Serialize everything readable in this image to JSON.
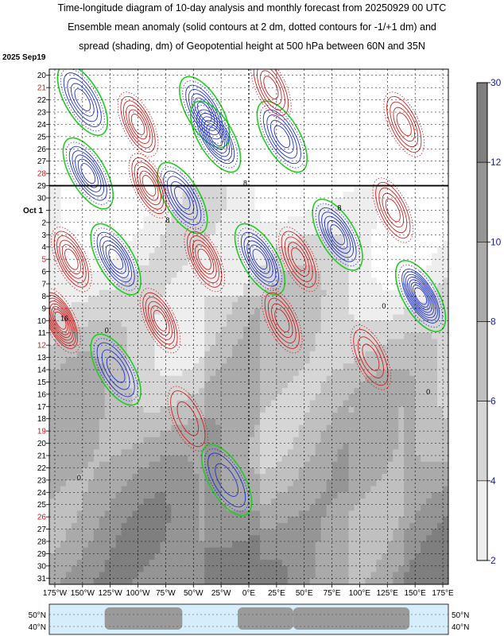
{
  "title": {
    "line1": "Time-longitude diagram of 10-day analysis and monthly forecast from 20250929 00 UTC",
    "line2": "Ensemble mean anomaly (solid contours at 2 dm, dotted contours for -1/+1 dm) and",
    "line3": "spread (shading, dm) of Geopotential height at 500 hPa between 60N and 35N"
  },
  "start_label": "2025 Sep19",
  "colors": {
    "positive": "#d42020",
    "negative": "#2233cc",
    "zero": "#22cc22",
    "weekend": "#dd1111",
    "colorbar_labels": "#1a1aa0"
  },
  "chart_data": {
    "type": "heatmap",
    "subtype": "time-longitude (Hovmoller) diagram",
    "analysis_end_line": "29",
    "y_ticks": [
      {
        "label": "20",
        "weekend": false
      },
      {
        "label": "21",
        "weekend": true
      },
      {
        "label": "22",
        "weekend": false
      },
      {
        "label": "23",
        "weekend": false
      },
      {
        "label": "24",
        "weekend": false
      },
      {
        "label": "25",
        "weekend": false
      },
      {
        "label": "26",
        "weekend": false
      },
      {
        "label": "27",
        "weekend": false
      },
      {
        "label": "28",
        "weekend": true
      },
      {
        "label": "29",
        "weekend": false
      },
      {
        "label": "30",
        "weekend": false
      },
      {
        "label": "Oct 1",
        "weekend": false
      },
      {
        "label": "2",
        "weekend": false
      },
      {
        "label": "3",
        "weekend": false
      },
      {
        "label": "4",
        "weekend": false
      },
      {
        "label": "5",
        "weekend": true
      },
      {
        "label": "6",
        "weekend": false
      },
      {
        "label": "7",
        "weekend": false
      },
      {
        "label": "8",
        "weekend": false
      },
      {
        "label": "9",
        "weekend": false
      },
      {
        "label": "10",
        "weekend": false
      },
      {
        "label": "11",
        "weekend": false
      },
      {
        "label": "12",
        "weekend": true
      },
      {
        "label": "13",
        "weekend": false
      },
      {
        "label": "14",
        "weekend": false
      },
      {
        "label": "15",
        "weekend": false
      },
      {
        "label": "16",
        "weekend": false
      },
      {
        "label": "17",
        "weekend": false
      },
      {
        "label": "18",
        "weekend": false
      },
      {
        "label": "19",
        "weekend": true
      },
      {
        "label": "20",
        "weekend": false
      },
      {
        "label": "21",
        "weekend": false
      },
      {
        "label": "22",
        "weekend": false
      },
      {
        "label": "23",
        "weekend": false
      },
      {
        "label": "24",
        "weekend": false
      },
      {
        "label": "25",
        "weekend": false
      },
      {
        "label": "26",
        "weekend": true
      },
      {
        "label": "27",
        "weekend": false
      },
      {
        "label": "28",
        "weekend": false
      },
      {
        "label": "29",
        "weekend": false
      },
      {
        "label": "30",
        "weekend": false
      },
      {
        "label": "31",
        "weekend": false
      }
    ],
    "x_ticks": [
      "175°W",
      "150°W",
      "125°W",
      "100°W",
      "75°W",
      "50°W",
      "25°W",
      "0°E",
      "25°E",
      "50°E",
      "75°E",
      "100°E",
      "125°E",
      "150°E",
      "175°E"
    ],
    "xlim": [
      -180,
      180
    ],
    "colorbar": {
      "ticks": [
        "30",
        "12",
        "10",
        "8",
        "6",
        "4",
        "2"
      ]
    },
    "shading_levels": [
      {
        "lo": 2,
        "hi": 4,
        "color": "#eeeeee"
      },
      {
        "lo": 4,
        "hi": 6,
        "color": "#d6d6d6"
      },
      {
        "lo": 6,
        "hi": 8,
        "color": "#c0c0c0"
      },
      {
        "lo": 8,
        "hi": 10,
        "color": "#aaaaaa"
      },
      {
        "lo": 10,
        "hi": 12,
        "color": "#959595"
      },
      {
        "lo": 12,
        "hi": 30,
        "color": "#7f7f7f"
      }
    ],
    "contour_labels": [
      "0",
      "8",
      "16"
    ],
    "anomaly_centers": [
      {
        "lon": -150,
        "day": 22,
        "sign": "-",
        "amp": 8
      },
      {
        "lon": -40,
        "day": 23,
        "sign": "-",
        "amp": 10
      },
      {
        "lon": -30,
        "day": 25,
        "sign": "-",
        "amp": 12
      },
      {
        "lon": 30,
        "day": 25,
        "sign": "-",
        "amp": 8
      },
      {
        "lon": -145,
        "day": 28,
        "sign": "-",
        "amp": 10
      },
      {
        "lon": -60,
        "day": 30,
        "sign": "-",
        "amp": 8
      },
      {
        "lon": 80,
        "day": 33,
        "sign": "-",
        "amp": 10
      },
      {
        "lon": -120,
        "day": 35,
        "sign": "-",
        "amp": 10
      },
      {
        "lon": 10,
        "day": 35,
        "sign": "-",
        "amp": 10
      },
      {
        "lon": 155,
        "day": 38,
        "sign": "-",
        "amp": 16
      },
      {
        "lon": -120,
        "day": 44,
        "sign": "-",
        "amp": 6
      },
      {
        "lon": -20,
        "day": 53,
        "sign": "-",
        "amp": 4
      },
      {
        "lon": -100,
        "day": 24,
        "sign": "+",
        "amp": 10
      },
      {
        "lon": 20,
        "day": 21,
        "sign": "+",
        "amp": 8
      },
      {
        "lon": 140,
        "day": 24,
        "sign": "+",
        "amp": 8
      },
      {
        "lon": -90,
        "day": 29,
        "sign": "+",
        "amp": 10
      },
      {
        "lon": -160,
        "day": 35,
        "sign": "+",
        "amp": 10
      },
      {
        "lon": -40,
        "day": 35,
        "sign": "+",
        "amp": 10
      },
      {
        "lon": 45,
        "day": 35,
        "sign": "+",
        "amp": 8
      },
      {
        "lon": 130,
        "day": 31,
        "sign": "+",
        "amp": 8
      },
      {
        "lon": -170,
        "day": 40,
        "sign": "+",
        "amp": 16
      },
      {
        "lon": -80,
        "day": 40,
        "sign": "+",
        "amp": 10
      },
      {
        "lon": 30,
        "day": 40,
        "sign": "+",
        "amp": 8
      },
      {
        "lon": 110,
        "day": 43,
        "sign": "+",
        "amp": 6
      },
      {
        "lon": -55,
        "day": 48,
        "sign": "+",
        "amp": 4
      }
    ]
  },
  "map": {
    "lat_labels": [
      "50°N",
      "40°N"
    ]
  }
}
